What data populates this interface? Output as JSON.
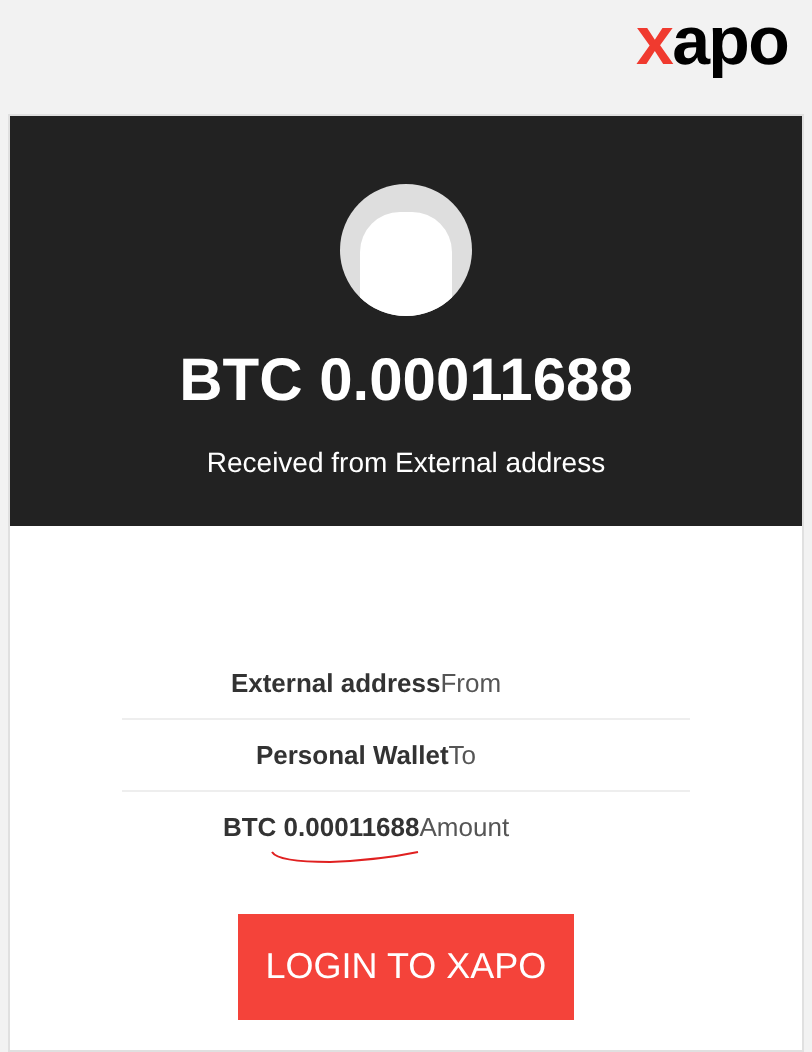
{
  "logo": {
    "accent": "x",
    "rest": "apo"
  },
  "hero": {
    "amount": "BTC 0.00011688",
    "subtitle": "Received from External address"
  },
  "details": [
    {
      "value": "External address",
      "label": "From"
    },
    {
      "value": "Personal Wallet",
      "label": "To"
    },
    {
      "value": "BTC **0.00011688**",
      "label": "Amount"
    }
  ],
  "button": {
    "label": "LOGIN TO XAPO"
  }
}
